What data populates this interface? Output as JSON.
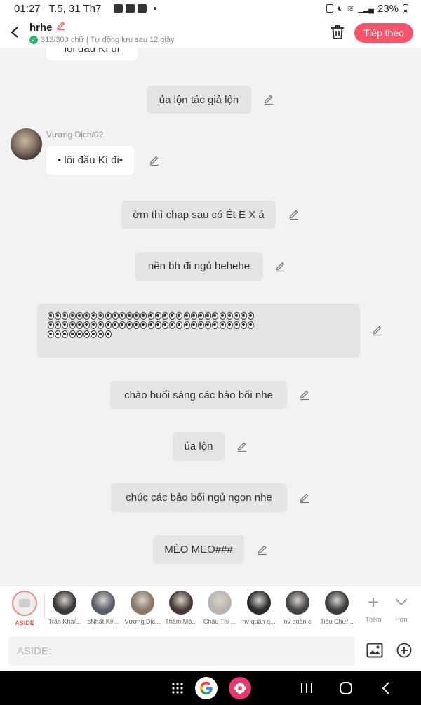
{
  "status_bar": {
    "time": "01:27",
    "date": "T.5, 31 Th7",
    "battery": "23%"
  },
  "header": {
    "title": "hrhe",
    "subtitle": "312/300 chữ | Tự động lưu sau 12 giây",
    "follow_label": "Tiếp theo"
  },
  "chat": {
    "top_partial": "lôi đầu Kì đi",
    "messages": [
      {
        "text": "ủa lộn tác giả lộn"
      },
      {
        "sender": "Vương Dịch/02",
        "text": "• lôi đầu Kì đi•"
      },
      {
        "text": "ờm thì chap sau có Ét E X á"
      },
      {
        "text": "nền bh đi ngủ hehehe"
      },
      {
        "text": "chào buổi sáng các bảo bối nhe"
      },
      {
        "text": "ủa lộn"
      },
      {
        "text": "chúc các bảo bối ngủ ngon nhe"
      },
      {
        "text": "MÈO MEO###"
      }
    ]
  },
  "characters": [
    {
      "name": "ASIDE",
      "color": "#eeeeee"
    },
    {
      "name": "Trần Kha/...",
      "color": "#3a3a3a"
    },
    {
      "name": "sNhất Kì/...",
      "color": "#5a5f6a"
    },
    {
      "name": "Vương Dịc...",
      "color": "#8a7767"
    },
    {
      "name": "Thẩm Mộ...",
      "color": "#4a3a36"
    },
    {
      "name": "Châu Thi ...",
      "color": "#b9b4ae"
    },
    {
      "name": "nv quần q...",
      "color": "#2a2a2a"
    },
    {
      "name": "nv quần c",
      "color": "#444444"
    },
    {
      "name": "Tiêu Chư/...",
      "color": "#3c3c3c"
    }
  ],
  "tools": {
    "add": "Thêm",
    "more": "Hơn"
  },
  "input": {
    "placeholder": "ASIDE:"
  }
}
